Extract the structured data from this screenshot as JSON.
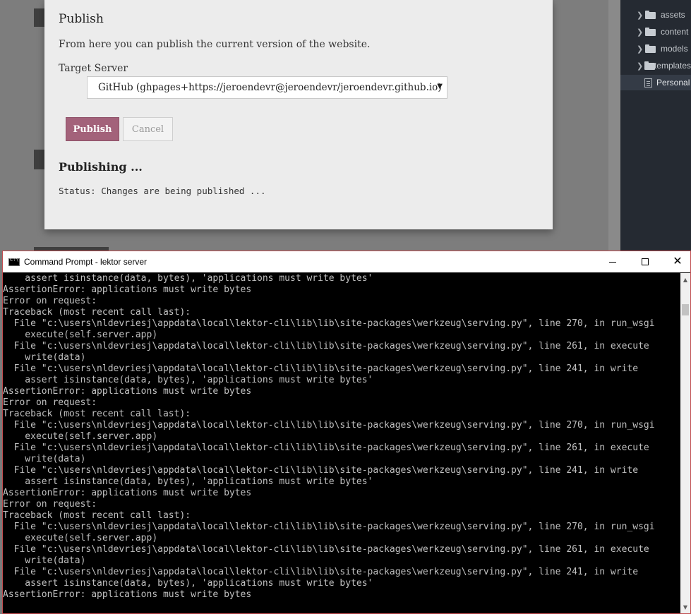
{
  "sidebar": {
    "items": [
      {
        "label": "assets",
        "type": "folder"
      },
      {
        "label": "content",
        "type": "folder"
      },
      {
        "label": "models",
        "type": "folder"
      },
      {
        "label": "templates",
        "type": "folder"
      },
      {
        "label": "Personal",
        "type": "file",
        "active": true
      }
    ]
  },
  "dialog": {
    "title": "Publish",
    "description": "From here you can publish the current version of the website.",
    "target_label": "Target Server",
    "selected_server": "GitHub (ghpages+https://jeroendevr@jeroendevr/jeroendevr.github.io)",
    "publish_label": "Publish",
    "cancel_label": "Cancel",
    "publishing_heading": "Publishing ...",
    "status": "Status: Changes are being published ..."
  },
  "cmd": {
    "title": "Command Prompt - lektor  server",
    "lines": [
      "    assert isinstance(data, bytes), 'applications must write bytes'",
      "AssertionError: applications must write bytes",
      "Error on request:",
      "Traceback (most recent call last):",
      "  File \"c:\\users\\nldevriesj\\appdata\\local\\lektor-cli\\lib\\lib\\site-packages\\werkzeug\\serving.py\", line 270, in run_wsgi",
      "    execute(self.server.app)",
      "  File \"c:\\users\\nldevriesj\\appdata\\local\\lektor-cli\\lib\\lib\\site-packages\\werkzeug\\serving.py\", line 261, in execute",
      "    write(data)",
      "  File \"c:\\users\\nldevriesj\\appdata\\local\\lektor-cli\\lib\\lib\\site-packages\\werkzeug\\serving.py\", line 241, in write",
      "    assert isinstance(data, bytes), 'applications must write bytes'",
      "AssertionError: applications must write bytes",
      "Error on request:",
      "Traceback (most recent call last):",
      "  File \"c:\\users\\nldevriesj\\appdata\\local\\lektor-cli\\lib\\lib\\site-packages\\werkzeug\\serving.py\", line 270, in run_wsgi",
      "    execute(self.server.app)",
      "  File \"c:\\users\\nldevriesj\\appdata\\local\\lektor-cli\\lib\\lib\\site-packages\\werkzeug\\serving.py\", line 261, in execute",
      "    write(data)",
      "  File \"c:\\users\\nldevriesj\\appdata\\local\\lektor-cli\\lib\\lib\\site-packages\\werkzeug\\serving.py\", line 241, in write",
      "    assert isinstance(data, bytes), 'applications must write bytes'",
      "AssertionError: applications must write bytes",
      "Error on request:",
      "Traceback (most recent call last):",
      "  File \"c:\\users\\nldevriesj\\appdata\\local\\lektor-cli\\lib\\lib\\site-packages\\werkzeug\\serving.py\", line 270, in run_wsgi",
      "    execute(self.server.app)",
      "  File \"c:\\users\\nldevriesj\\appdata\\local\\lektor-cli\\lib\\lib\\site-packages\\werkzeug\\serving.py\", line 261, in execute",
      "    write(data)",
      "  File \"c:\\users\\nldevriesj\\appdata\\local\\lektor-cli\\lib\\lib\\site-packages\\werkzeug\\serving.py\", line 241, in write",
      "    assert isinstance(data, bytes), 'applications must write bytes'",
      "AssertionError: applications must write bytes"
    ]
  },
  "colors": {
    "publish_button": "#a3627a",
    "console_bg": "#000000",
    "console_text": "#c0c0c0",
    "sidebar_bg": "#252a32"
  }
}
